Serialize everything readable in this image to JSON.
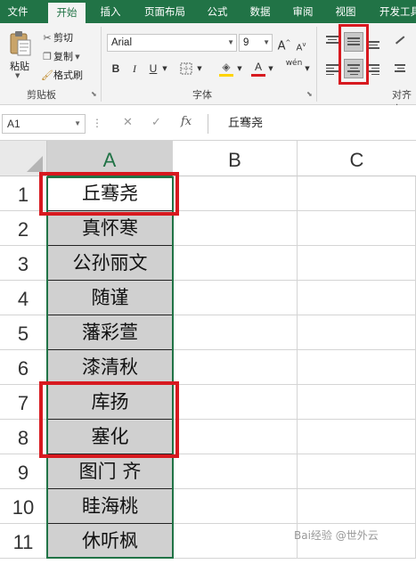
{
  "ribbon_tabs": [
    {
      "label": "文件",
      "active": false
    },
    {
      "label": "开始",
      "active": true
    },
    {
      "label": "插入",
      "active": false
    },
    {
      "label": "页面布局",
      "active": false
    },
    {
      "label": "公式",
      "active": false
    },
    {
      "label": "数据",
      "active": false
    },
    {
      "label": "审阅",
      "active": false
    },
    {
      "label": "视图",
      "active": false
    },
    {
      "label": "开发工具",
      "active": false
    }
  ],
  "clipboard": {
    "paste_label": "粘贴",
    "cut_label": "剪切",
    "copy_label": "复制",
    "format_painter_label": "格式刷",
    "group_label": "剪贴板"
  },
  "font": {
    "name": "Arial",
    "size": "9",
    "group_label": "字体",
    "bold": "B",
    "italic": "I",
    "underline": "U",
    "grow": "A",
    "shrink": "A",
    "font_color_glyph": "A",
    "phonetic_glyph": "wén",
    "font_color": "#d7191f",
    "fill_color": "#ffd400"
  },
  "alignment": {
    "group_label": "对齐方",
    "selected_option": "vertical-center, horizontal-center"
  },
  "formula_bar": {
    "name_box": "A1",
    "fx_label": "fx",
    "content": "丘骞尧"
  },
  "sheet": {
    "columns": [
      "A",
      "B",
      "C"
    ],
    "selected_column": "A",
    "rows": [
      {
        "num": "1",
        "value": "丘骞尧"
      },
      {
        "num": "2",
        "value": "真怀寒"
      },
      {
        "num": "3",
        "value": "公孙丽文"
      },
      {
        "num": "4",
        "value": "随谨"
      },
      {
        "num": "5",
        "value": "藩彩萱"
      },
      {
        "num": "6",
        "value": "漆清秋"
      },
      {
        "num": "7",
        "value": "库扬"
      },
      {
        "num": "8",
        "value": "塞化"
      },
      {
        "num": "9",
        "value": "图门 齐"
      },
      {
        "num": "10",
        "value": "眭海桃"
      },
      {
        "num": "11",
        "value": "休听枫"
      }
    ],
    "grid_color": "#217346",
    "highlight_color": "#d7191f"
  },
  "watermark": "Bai经验 @世外云"
}
